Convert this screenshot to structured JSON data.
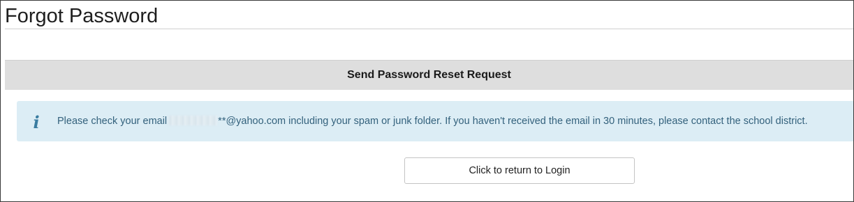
{
  "page": {
    "title": "Forgot Password"
  },
  "section": {
    "header": "Send Password Reset Request"
  },
  "alert": {
    "icon": "info-icon",
    "text_before": "Please check your email",
    "text_after": "**@yahoo.com including your spam or junk folder. If you haven't received the email in 30 minutes, please contact the school district."
  },
  "actions": {
    "return_label": "Click to return to Login"
  },
  "colors": {
    "alert_background": "#dcedf5",
    "alert_text": "#33617c",
    "header_background": "#dedede"
  }
}
